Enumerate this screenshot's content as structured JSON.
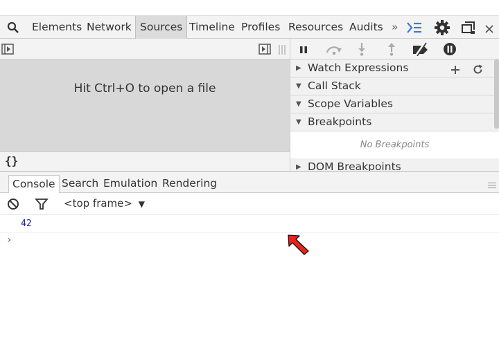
{
  "toolbar": {
    "tabs": [
      {
        "label": "Elements"
      },
      {
        "label": "Network"
      },
      {
        "label": "Sources",
        "selected": true
      },
      {
        "label": "Timeline"
      },
      {
        "label": "Profiles"
      },
      {
        "label": "Resources"
      },
      {
        "label": "Audits"
      }
    ],
    "overflow_label": "»"
  },
  "sources": {
    "empty_message": "Hit Ctrl+O to open a file",
    "pretty_print_label": "{}"
  },
  "debugger": {
    "sections": [
      {
        "label": "Watch Expressions",
        "expanded": false
      },
      {
        "label": "Call Stack",
        "expanded": true
      },
      {
        "label": "Scope Variables",
        "expanded": true
      },
      {
        "label": "Breakpoints",
        "expanded": true
      },
      {
        "label": "DOM Breakpoints",
        "expanded": false
      }
    ],
    "no_breakpoints": "No Breakpoints"
  },
  "drawer": {
    "tabs": [
      {
        "label": "Console",
        "selected": true
      },
      {
        "label": "Search"
      },
      {
        "label": "Emulation"
      },
      {
        "label": "Rendering"
      }
    ]
  },
  "console": {
    "frame_selector": "<top frame>",
    "messages": [
      {
        "text": "42"
      }
    ],
    "prompt": "›"
  },
  "colors": {
    "accent_blue": "#3b78e7",
    "editor_bg": "#d8d8d8",
    "cursor_red": "#e8231a"
  }
}
